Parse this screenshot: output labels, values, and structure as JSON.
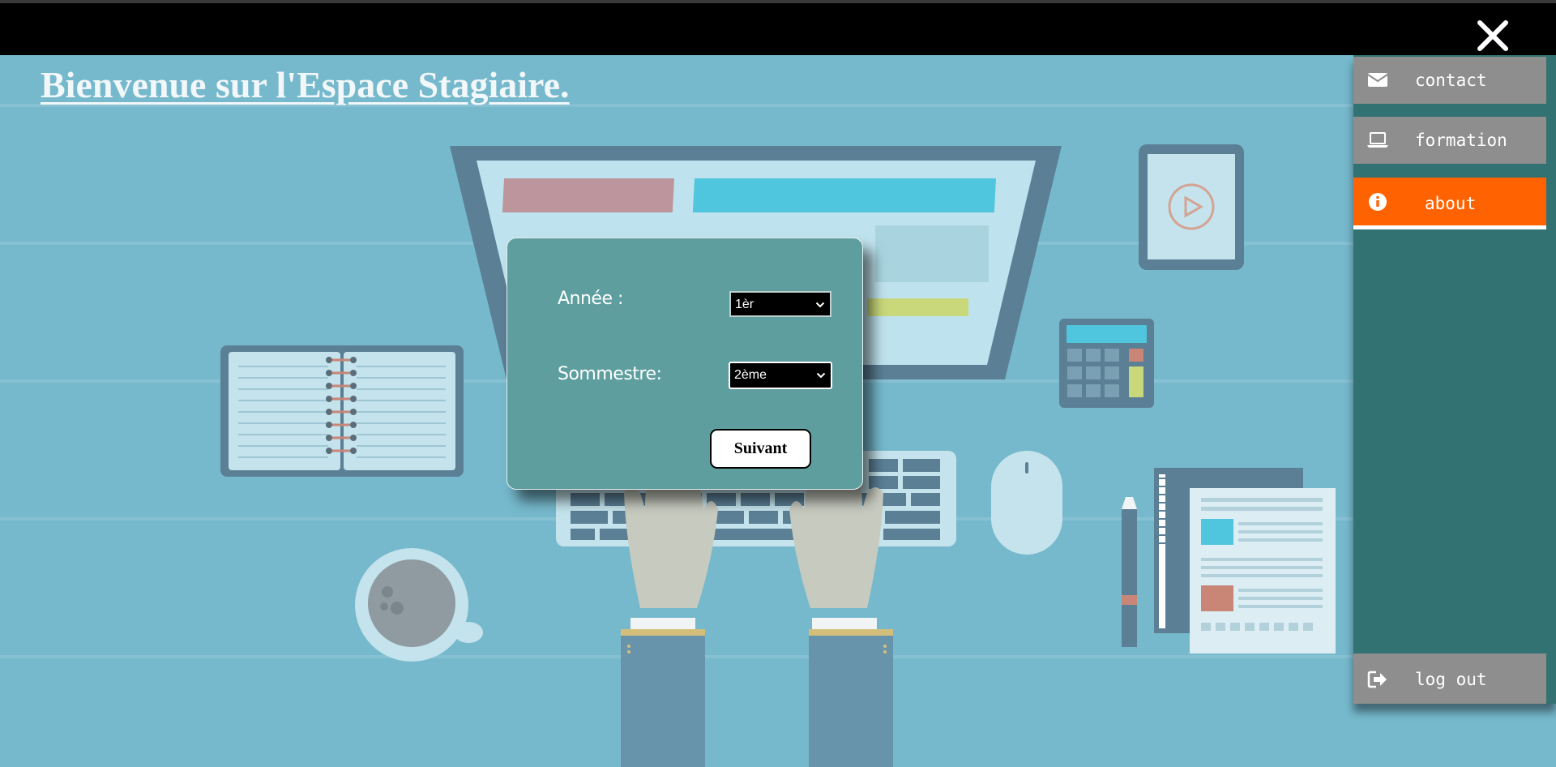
{
  "header": {
    "close_icon": "close-x-icon"
  },
  "page": {
    "title": "Bienvenue sur l'Espace Stagiaire."
  },
  "form": {
    "annee_label": "Année :",
    "annee_value": "1èr",
    "semestre_label": "Sommestre:",
    "semestre_value": "2ème",
    "submit_label": "Suivant"
  },
  "sidebar": {
    "items": [
      {
        "label": "contact",
        "icon": "envelope-icon"
      },
      {
        "label": "formation",
        "icon": "laptop-icon"
      },
      {
        "label": "about",
        "icon": "info-icon",
        "active": true
      },
      {
        "label": "log out",
        "icon": "sign-out-icon"
      }
    ]
  },
  "colors": {
    "background": "#76b9cd",
    "topbar": "#000000",
    "modal": "#5e9e9e",
    "sidebar": "#327272",
    "nav_item": "#8e8e8e",
    "nav_active": "#ff6200"
  }
}
